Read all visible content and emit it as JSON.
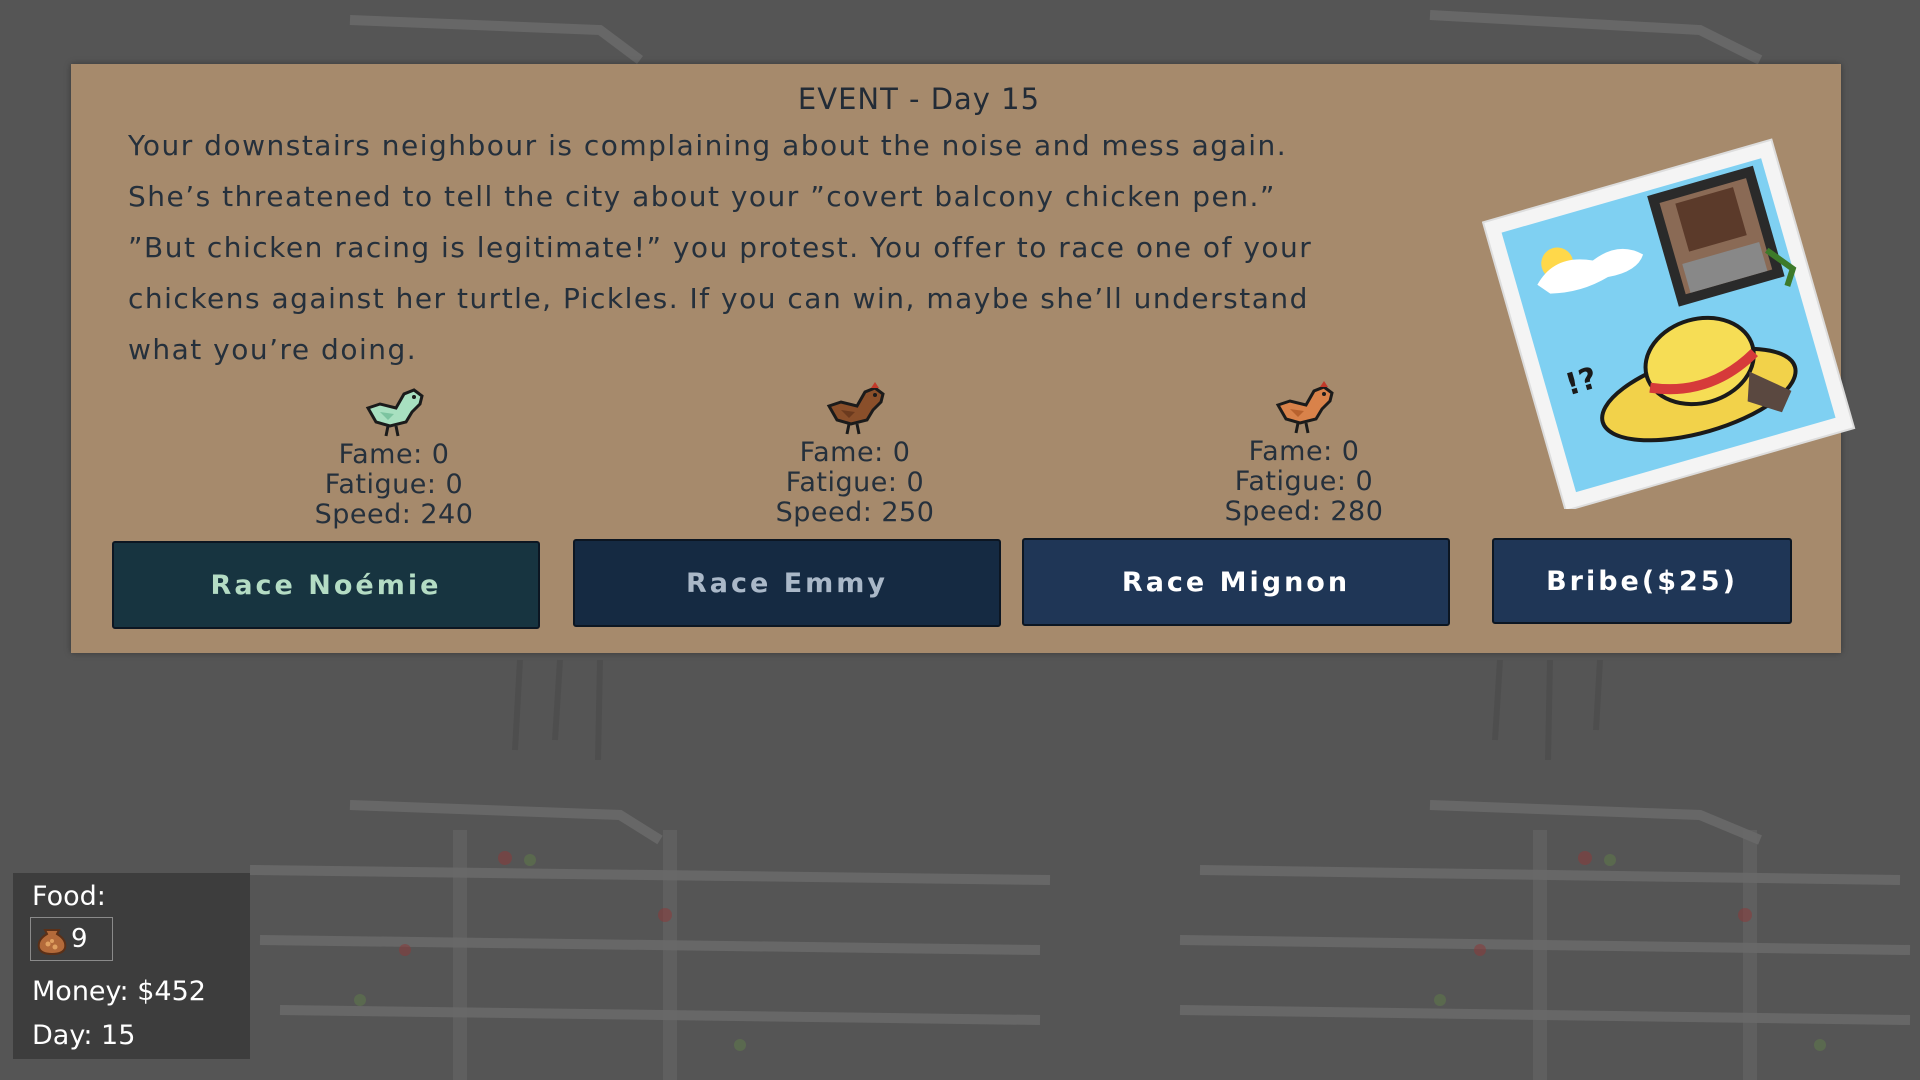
{
  "event": {
    "title": "EVENT - Day 15",
    "text_lines": [
      "Your downstairs neighbour is complaining about the noise and mess again.",
      "She’s threatened to tell the city about your ”covert balcony chicken pen.”",
      "”But chicken racing is legitimate!” you protest. You offer to race one of your",
      "chickens against her turtle, Pickles. If you can win, maybe she’ll understand",
      "what you’re doing."
    ]
  },
  "chickens": [
    {
      "name": "Noémie",
      "fame": "Fame: 0",
      "fatigue": "Fatigue: 0",
      "speed": "Speed: 240",
      "button": "Race Noémie",
      "body_color": "#a8e0c0",
      "button_bg": "#173440",
      "button_fg": "#b4dcc4"
    },
    {
      "name": "Emmy",
      "fame": "Fame: 0",
      "fatigue": "Fatigue: 0",
      "speed": "Speed: 250",
      "button": "Race Emmy",
      "body_color": "#8a4f2a",
      "button_bg": "#152a42",
      "button_fg": "#aab8c8"
    },
    {
      "name": "Mignon",
      "fame": "Fame: 0",
      "fatigue": "Fatigue: 0",
      "speed": "Speed: 280",
      "button": "Race Mignon",
      "body_color": "#d9824a",
      "button_bg": "#1f3656",
      "button_fg": "#ffffff"
    }
  ],
  "bribe": {
    "label": "Bribe($25)",
    "button_bg": "#1f3656",
    "button_fg": "#ffffff"
  },
  "hud": {
    "food_label": "Food:",
    "food_count": "9",
    "food_icon": "food-bag-icon",
    "money": "Money: $452",
    "day": "Day: 15"
  },
  "colors": {
    "panel": "#a68a6c",
    "background": "#555555",
    "text_dark": "#25303c"
  }
}
